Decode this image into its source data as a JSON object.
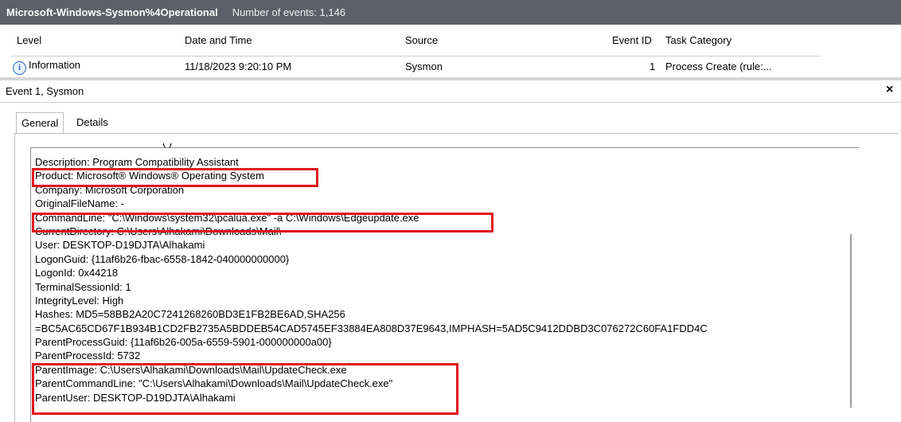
{
  "header": {
    "log_name": "Microsoft-Windows-Sysmon%4Operational",
    "event_count": "Number of events: 1,146"
  },
  "columns": {
    "level": "Level",
    "date": "Date and Time",
    "source": "Source",
    "event_id": "Event ID",
    "task": "Task Category"
  },
  "row": {
    "level": "Information",
    "date": "11/18/2023 9:20:10 PM",
    "source": "Sysmon",
    "event_id": "1",
    "task": "Process Create (rule:..."
  },
  "event": {
    "title": "Event 1, Sysmon",
    "close": "×",
    "tab_general": "General",
    "tab_details": "Details"
  },
  "details": {
    "cut": "(                )",
    "lines": [
      "Description: Program Compatibility Assistant",
      "Product: Microsoft® Windows® Operating System",
      "Company: Microsoft Corporation",
      "OriginalFileName: -",
      "CommandLine: \"C:\\Windows\\system32\\pcalua.exe\" -a C:\\Windows\\Edgeupdate.exe",
      "CurrentDirectory: C:\\Users\\Alhakami\\Downloads\\Mail\\",
      "User: DESKTOP-D19DJTA\\Alhakami",
      "LogonGuid: {11af6b26-fbac-6558-1842-040000000000}",
      "LogonId: 0x44218",
      "TerminalSessionId: 1",
      "IntegrityLevel: High",
      "Hashes: MD5=58BB2A20C7241268260BD3E1FB2BE6AD,SHA256",
      "=BC5AC65CD67F1B934B1CD2FB2735A5BDDEB54CAD5745EF33884EA808D37E9643,IMPHASH=5AD5C9412DDBD3C076272C60FA1FDD4C",
      "ParentProcessGuid: {11af6b26-005a-6559-5901-000000000a00}",
      "ParentProcessId: 5732",
      "ParentImage: C:\\Users\\Alhakami\\Downloads\\Mail\\UpdateCheck.exe",
      "ParentCommandLine: \"C:\\Users\\Alhakami\\Downloads\\Mail\\UpdateCheck.exe\"",
      "ParentUser: DESKTOP-D19DJTA\\Alhakami"
    ]
  },
  "colors": {
    "title_bar": "#5c6068",
    "highlight": "#e0141e"
  },
  "icons": {
    "level_icon": "information-icon"
  }
}
